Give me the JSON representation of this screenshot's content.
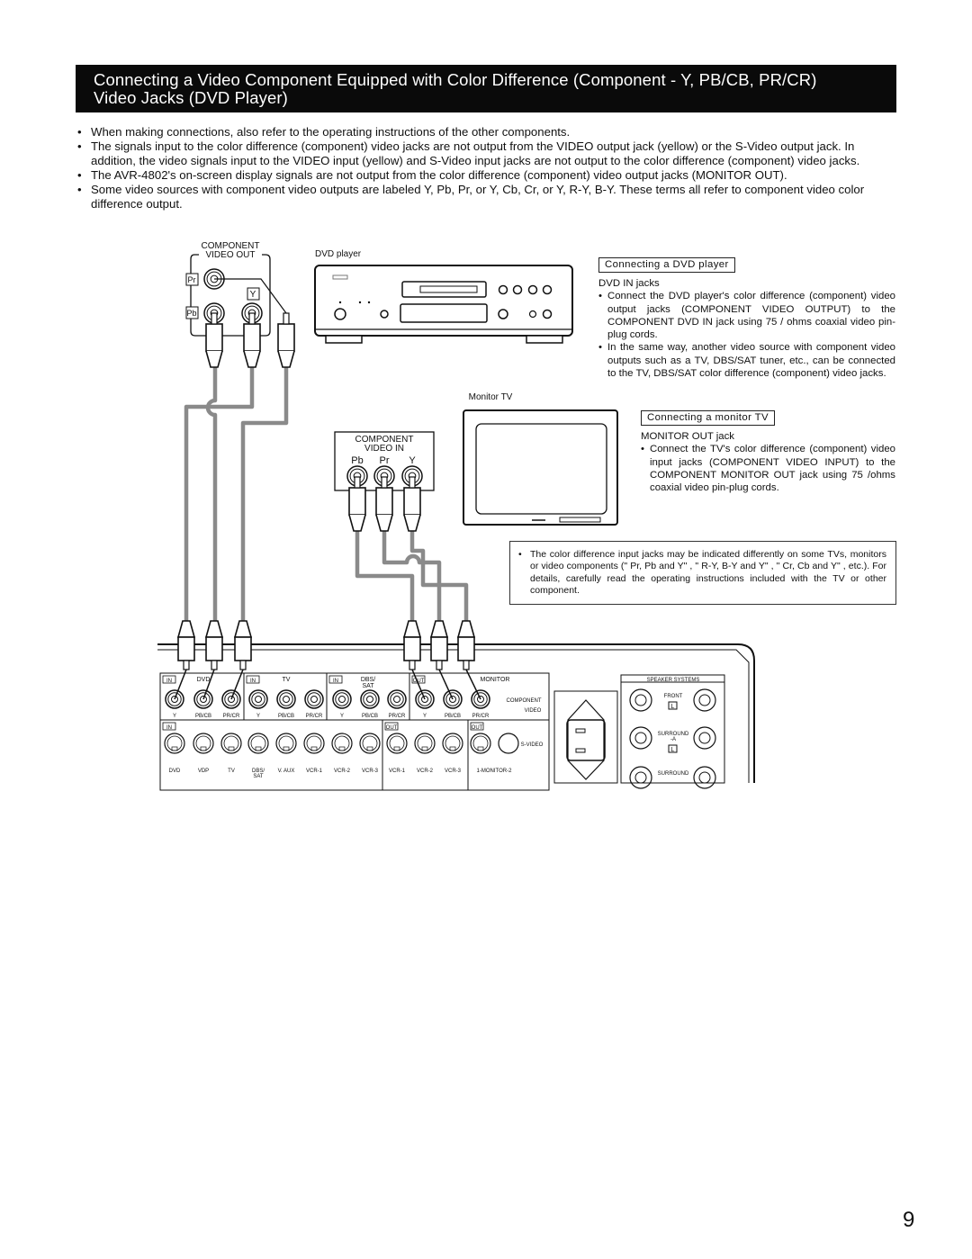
{
  "title": {
    "line1": "Connecting a Video Component Equipped with Color Difference (Component - Y, PB/CB, PR/CR)",
    "line2": "Video Jacks (DVD Player)"
  },
  "bullets": [
    "When making connections, also refer to the operating instructions of the other components.",
    "The signals input to the color difference (component) video jacks are not output from the VIDEO output jack (yellow) or the S-Video output jack. In addition, the video signals input to the VIDEO input (yellow) and S-Video input jacks are not output to the color difference (component) video jacks.",
    "The AVR-4802's on-screen display signals are not output from the color difference (component) video output jacks (MONITOR OUT).",
    "Some video sources with component video outputs are labeled Y, Pb, Pr, or Y, Cb, Cr, or Y, R-Y, B-Y. These terms all refer to component video color difference output."
  ],
  "dvd_section": {
    "header": "Connecting a DVD player",
    "subheader": "DVD IN jacks",
    "items": [
      "Connect the DVD player's color difference (component) video output jacks (COMPONENT VIDEO OUTPUT) to the COMPONENT DVD IN jack using 75  / ohms coaxial video pin-plug cords.",
      "In the same way, another video source with component video outputs such as a TV, DBS/SAT tuner, etc., can be connected to the TV, DBS/SAT color difference (component) video jacks."
    ]
  },
  "tv_section": {
    "header": "Connecting a monitor TV",
    "subheader": "MONITOR OUT jack",
    "items": [
      "Connect the TV's color difference (component) video input jacks (COMPONENT VIDEO INPUT) to the COMPONENT MONITOR OUT jack using 75  /ohms coaxial video pin-plug cords."
    ]
  },
  "note": "The color difference input jacks may be indicated differently on some TVs, monitors or video components (\" Pr, Pb and Y\" , \" R-Y, B-Y and Y\" , \" Cr, Cb and Y\" , etc.). For details, carefully read the operating instructions included with the TV or other component.",
  "diagram": {
    "dvd_out_label1": "COMPONENT",
    "dvd_out_label2": "VIDEO OUT",
    "pr": "Pr",
    "pb": "Pb",
    "y": "Y",
    "dvd_player": "DVD player",
    "monitor_tv": "Monitor TV",
    "tv_in_label1": "COMPONENT",
    "tv_in_label2": "VIDEO IN",
    "tv_jacks": [
      "Pb",
      "Pr",
      "Y"
    ],
    "receiver": {
      "in": "IN",
      "out": "OUT",
      "groups": [
        "DVD",
        "TV",
        "DBS/\nSAT",
        "MONITOR"
      ],
      "component_jacks": [
        "Y",
        "PB/CB",
        "PR/CR"
      ],
      "component_label1": "COMPONENT",
      "component_label2": "VIDEO",
      "svideo_label": "S-VIDEO",
      "svideo_jacks": [
        "DVD",
        "VDP",
        "TV",
        "DBS/\nSAT",
        "V. AUX",
        "VCR-1",
        "VCR-2",
        "VCR-3",
        "VCR-1",
        "VCR-2",
        "VCR-3",
        "1-MONITOR-2"
      ],
      "speaker_systems": "SPEAKER SYSTEMS",
      "front": "FRONT",
      "surround_a": "SURROUND\n-A",
      "surround": "SURROUND",
      "l": "L"
    },
    "cable_color": "#8a8a8a"
  },
  "page_number": "9"
}
